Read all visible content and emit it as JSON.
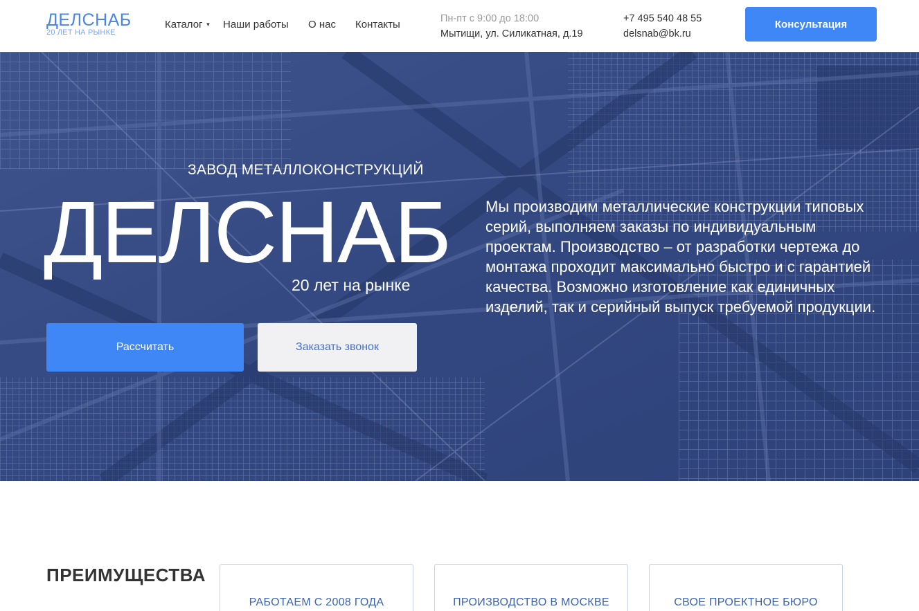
{
  "header": {
    "logo_title": "ДЕЛСНАБ",
    "logo_subtitle": "20 ЛЕТ НА РЫНКЕ",
    "nav": {
      "catalog": "Каталог",
      "works": "Наши работы",
      "about": "О нас",
      "contacts": "Контакты"
    },
    "hours": "Пн-пт с 9:00 до 18:00",
    "address": "Мытищи, ул. Силикатная, д.19",
    "phone": "+7 495 540 48 55",
    "email": "delsnab@bk.ru",
    "consult_button": "Консультация"
  },
  "hero": {
    "kicker": "ЗАВОД МЕТАЛЛОКОНСТРУКЦИЙ",
    "title": "ДЕЛСНАБ",
    "years": "20 лет на рынке",
    "calc_button": "Рассчитать",
    "call_button": "Заказать звонок",
    "description": "Мы производим металлические конструкции типовых серий, выполняем заказы по индивидуальным проектам. Производство – от разработки чертежа до монтажа проходит максимально быстро и с гарантией качества. Возможно изготовление как единичных изделий, так и серийный выпуск требуемой продукции."
  },
  "advantages": {
    "heading": "ПРЕИМУЩЕСТВА",
    "cards": [
      "РАБОТАЕМ С 2008 ГОДА",
      "ПРОИЗВОДСТВО В МОСКВЕ",
      "СВОЕ ПРОЕКТНОЕ БЮРО"
    ]
  },
  "colors": {
    "accent": "#3f86f7",
    "logo": "#4a86ea",
    "hero_tint": "#3a4f87"
  }
}
